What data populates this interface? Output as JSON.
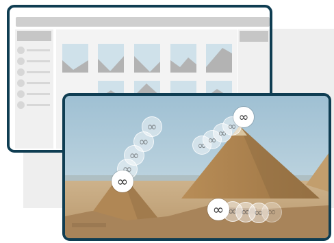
{
  "colors": {
    "frame_border": "#0f3d52",
    "background_panel": "#eeeeee",
    "placeholder_gray": "#cfcfcf",
    "thumbnail_sky": "#cfe1ea",
    "thumbnail_mountain": "#b3b3b3"
  },
  "icons": {
    "marker_icon": "infinity-icon",
    "thumbnail_icon": "mountain-image-icon"
  },
  "markers": {
    "symbol": "∞"
  }
}
